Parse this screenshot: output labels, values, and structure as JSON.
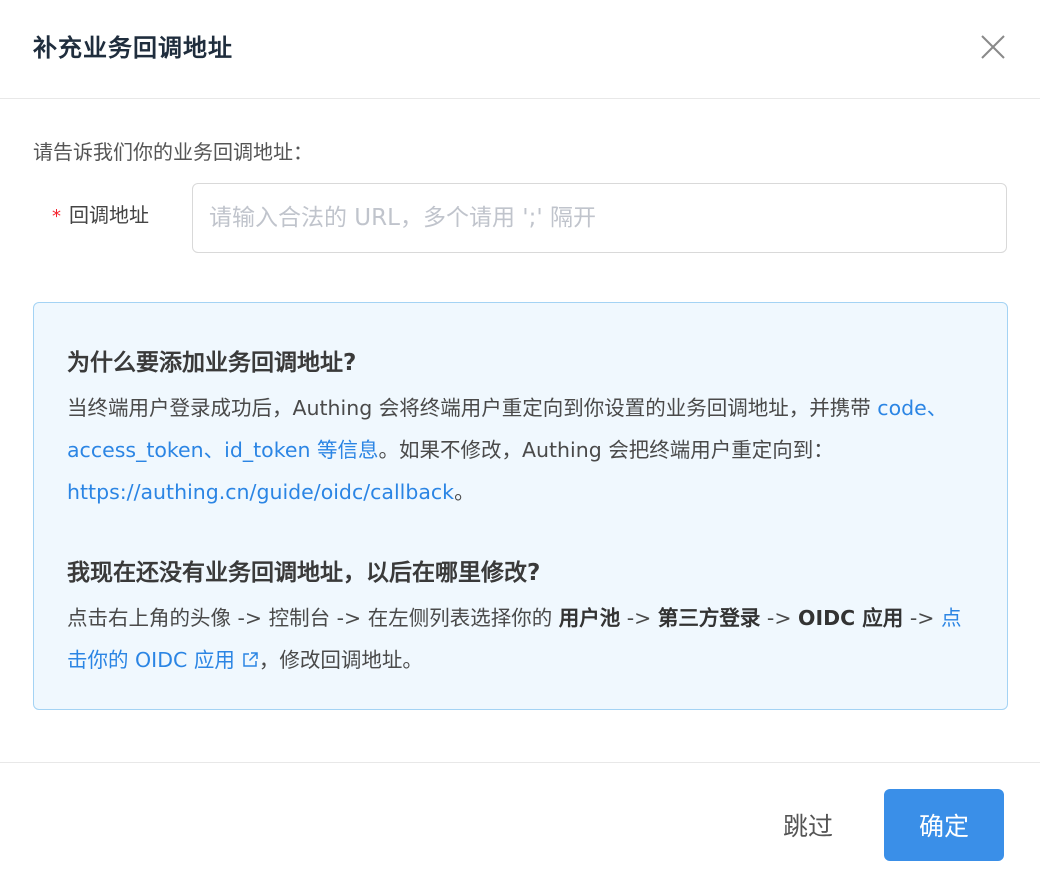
{
  "modal": {
    "title": "补充业务回调地址",
    "close_icon": "close-icon"
  },
  "form": {
    "prompt": "请告诉我们你的业务回调地址：",
    "required_mark": "*",
    "callback_label": "回调地址",
    "callback_placeholder": "请输入合法的 URL，多个请用 ';' 隔开",
    "callback_value": ""
  },
  "info": {
    "section1_title": "为什么要添加业务回调地址?",
    "section1_text_a": "当终端用户登录成功后，Authing 会将终端用户重定向到你设置的业务回调地址，并携带",
    "section1_highlight": "code、access_token、id_token 等信息",
    "section1_text_b": "。如果不修改，Authing 会把终端用户重定向到：",
    "section1_link": "https://authing.cn/guide/oidc/callback",
    "section1_text_c": "。",
    "section2_title": "我现在还没有业务回调地址，以后在哪里修改?",
    "section2_text_a": "点击右上角的头像 -> 控制台 -> 在左侧列表选择你的",
    "section2_bold_1": "用户池",
    "section2_arrow_1": "->",
    "section2_bold_2": "第三方登录",
    "section2_arrow_2": "->",
    "section2_bold_3": "OIDC 应用",
    "section2_arrow_3": "->",
    "section2_link": "点击你的 OIDC 应用",
    "section2_text_b": "，修改回调地址。",
    "external_link_icon": "external-link-icon"
  },
  "footer": {
    "skip_label": "跳过",
    "confirm_label": "确定"
  },
  "colors": {
    "accent": "#3a8fe8",
    "link": "#2b85e4",
    "required": "#f5222d",
    "info_bg": "#f0f8fe",
    "info_border": "#a4d3f4"
  }
}
